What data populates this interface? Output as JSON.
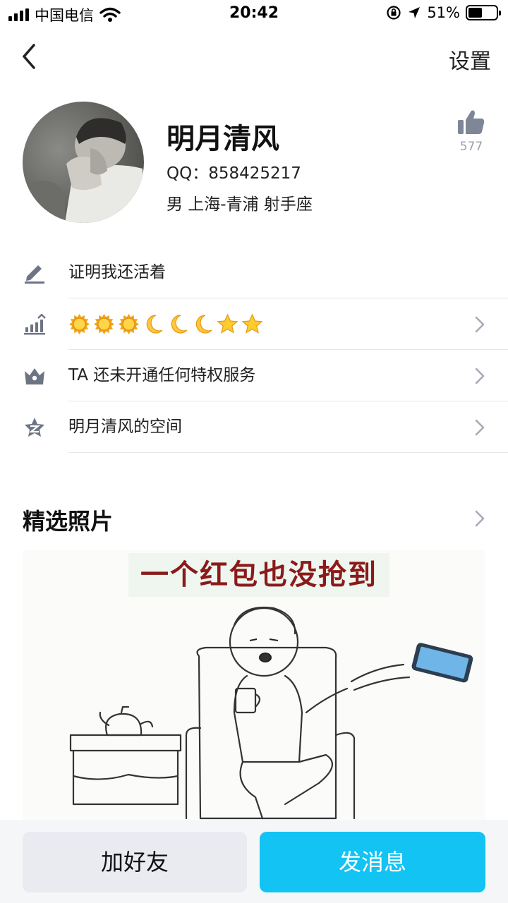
{
  "status_bar": {
    "carrier": "中国电信",
    "time": "20:42",
    "battery": "51%",
    "battery_level": 0.51
  },
  "nav": {
    "back_icon": "chevron-left-icon",
    "settings_label": "设置"
  },
  "profile": {
    "nickname": "明月清风",
    "qq": "QQ：858425217",
    "info": "男  上海-青浦  射手座",
    "likes": "577",
    "avatar_icon": "avatar"
  },
  "info_rows": [
    {
      "icon": "edit-icon",
      "text": "证明我还活着",
      "chevron": false
    },
    {
      "icon": "level-icon",
      "text": "",
      "chevron": true
    },
    {
      "icon": "crown-icon",
      "text": "TA 还未开通任何特权服务",
      "chevron": true
    },
    {
      "icon": "qzone-star-icon",
      "text": "明月清风的空间",
      "chevron": true
    }
  ],
  "level_badges": [
    "sun",
    "sun",
    "sun",
    "moon",
    "moon",
    "moon",
    "star",
    "star"
  ],
  "photos": {
    "title": "精选照片",
    "caption": "一个红包也没抢到"
  },
  "actions": {
    "add_friend": "加好友",
    "send_message": "发消息"
  },
  "colors": {
    "accent": "#12c3f4",
    "icon_gray": "#6d7584",
    "chevron_gray": "#a6abb5"
  }
}
